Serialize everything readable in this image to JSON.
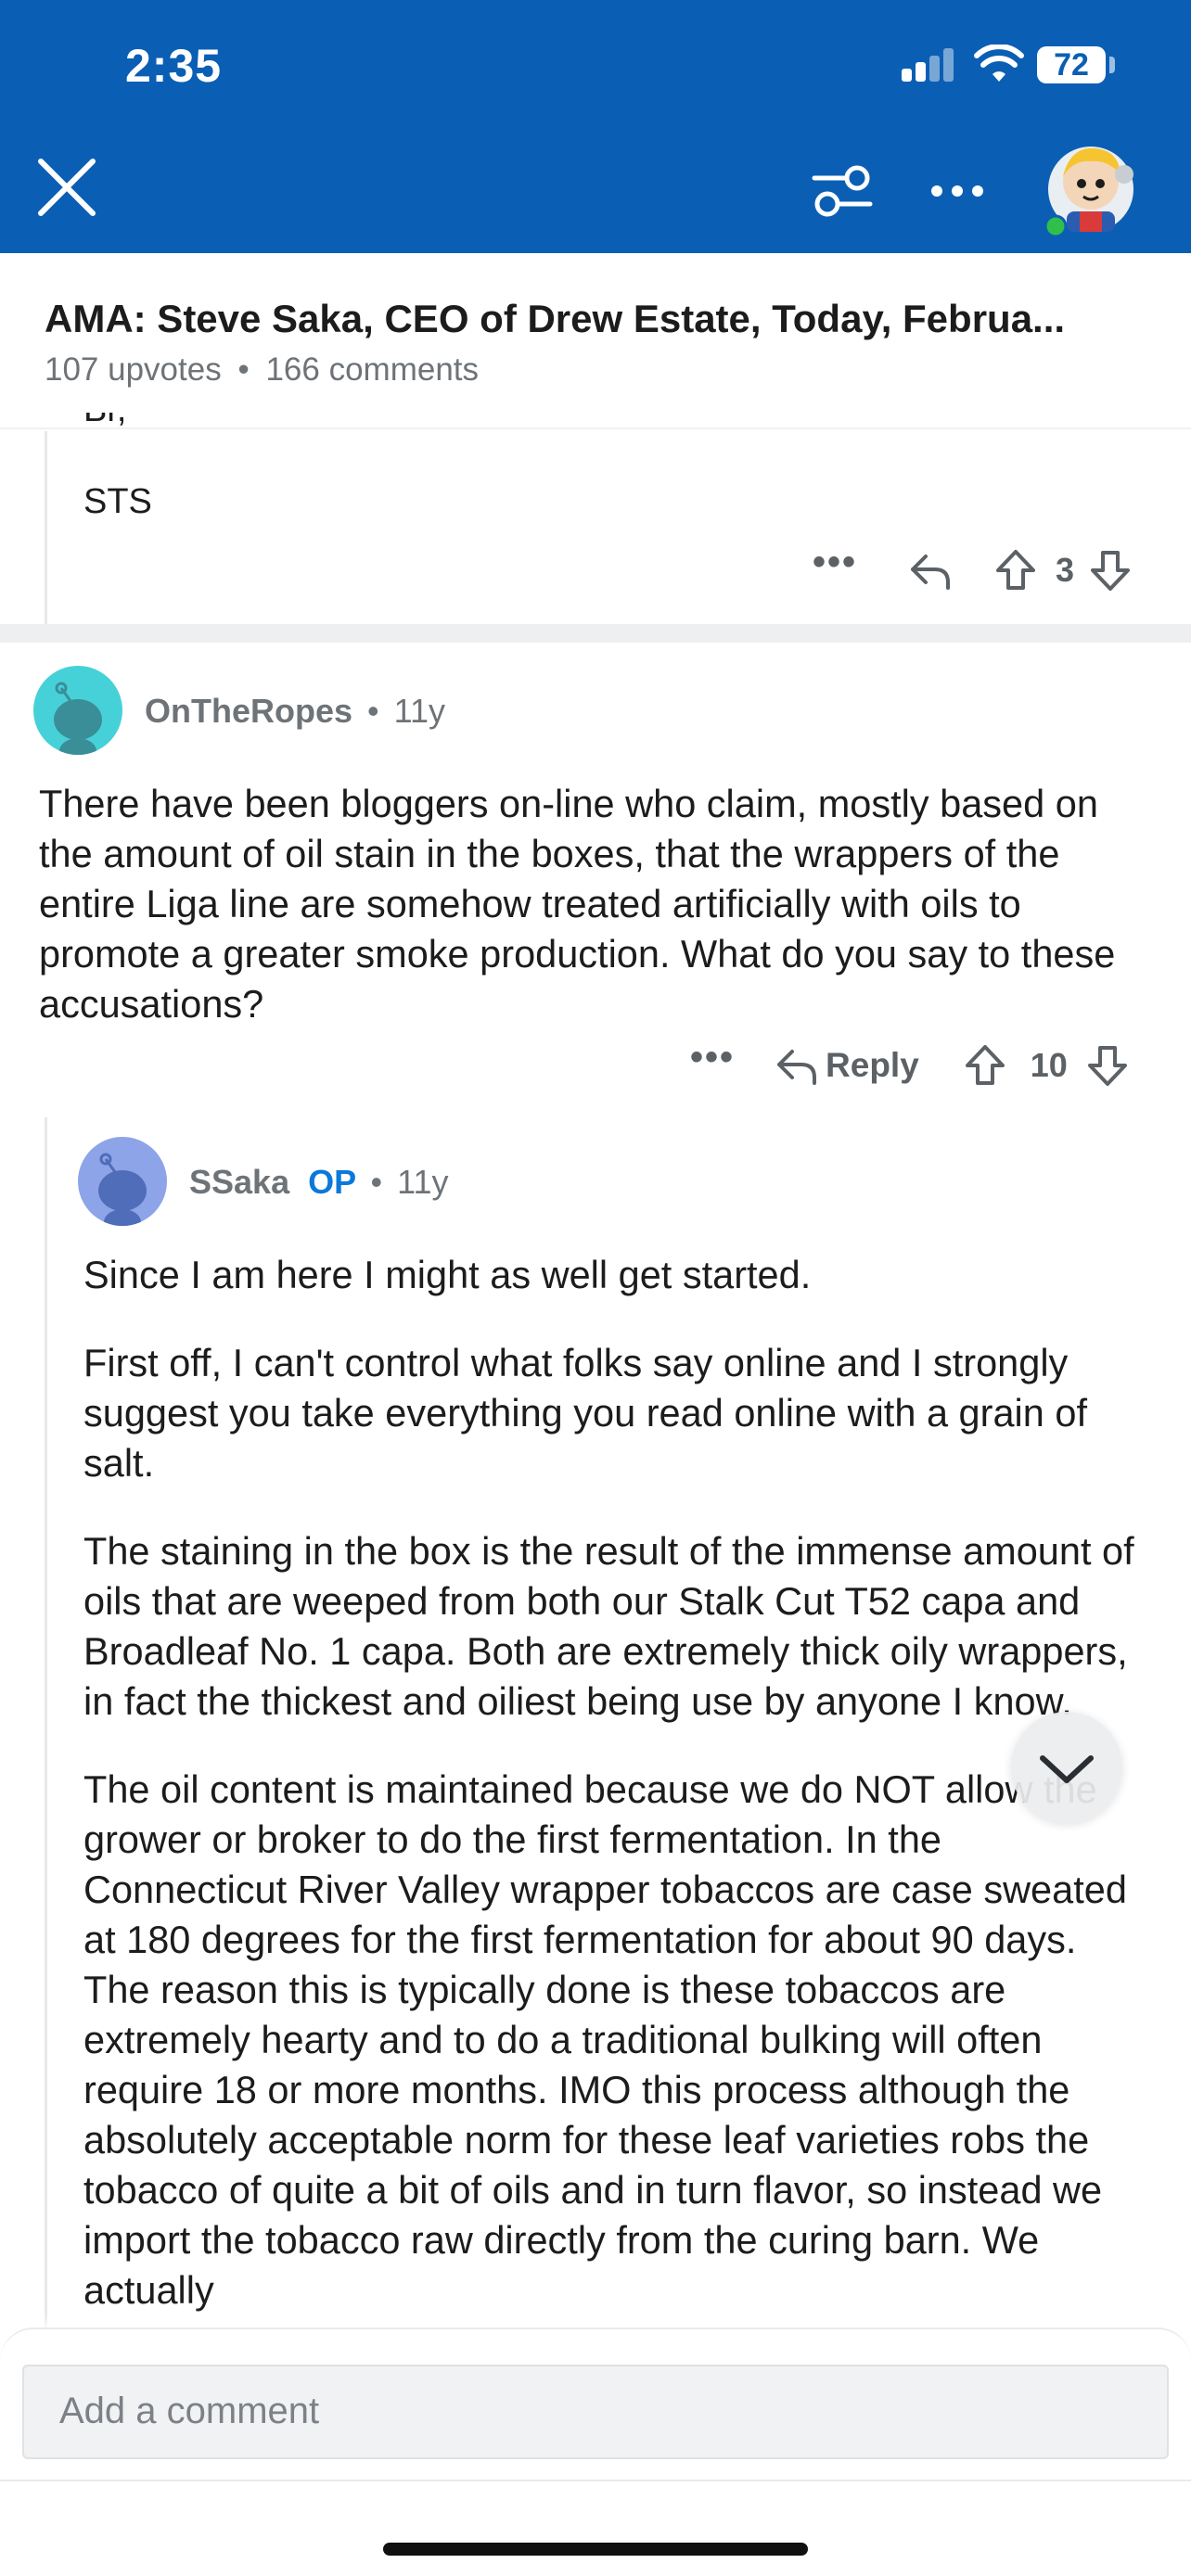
{
  "status_bar": {
    "time": "2:35",
    "battery": "72"
  },
  "header": {
    "close_icon": "close-icon",
    "filter_icon": "filter-sliders-icon",
    "more_icon": "more-horizontal-icon",
    "avatar_icon": "user-avatar-icon"
  },
  "post": {
    "title": "AMA: Steve Saka, CEO of Drew Estate, Today, Februa...",
    "upvotes": "107 upvotes",
    "separator": "•",
    "comments": "166 comments"
  },
  "prev_comment": {
    "partial_text": "Br,",
    "signature": "STS",
    "vote_count": "3"
  },
  "comment1": {
    "username": "OnTheRopes",
    "separator": "•",
    "age": "11y",
    "body": "There have been bloggers on-line who claim, mostly based on the amount of oil stain in the boxes, that the wrappers of the entire Liga line are somehow treated artificially with oils to promote a greater smoke production. What do you say to these accusations?",
    "reply_label": "Reply",
    "vote_count": "10"
  },
  "comment2": {
    "username": "SSaka",
    "op_badge": "OP",
    "separator": "•",
    "age": "11y",
    "paragraphs": [
      "Since I am here I might as well get started.",
      "First off, I can't control what folks say online and I strongly suggest you take everything you read online with a grain of salt.",
      "The staining in the box is the result of the immense amount of oils that are weeped from both our Stalk Cut T52 capa and Broadleaf No. 1 capa. Both are extremely thick oily wrappers, in fact the thickest and oiliest being use by anyone I know.",
      "The oil content is maintained because we do NOT allow the grower or broker to do the first fermentation. In the Connecticut River Valley wrapper tobaccos are case sweated at 180 degrees for the first fermentation for about 90 days. The reason this is typically done is these tobaccos are extremely hearty and to do a traditional bulking will often require 18 or more months. IMO this process although the absolutely acceptable norm for these leaf varieties robs the tobacco of quite a bit of oils and in turn flavor, so instead we import the tobacco raw directly from the curing barn. We actually"
    ]
  },
  "composer": {
    "placeholder": "Add a comment"
  },
  "colors": {
    "header_blue": "#0a5fb4",
    "op_blue": "#0a79d9",
    "avatar_teal": "#46d1d8",
    "avatar_lavender": "#8ea4e8"
  }
}
